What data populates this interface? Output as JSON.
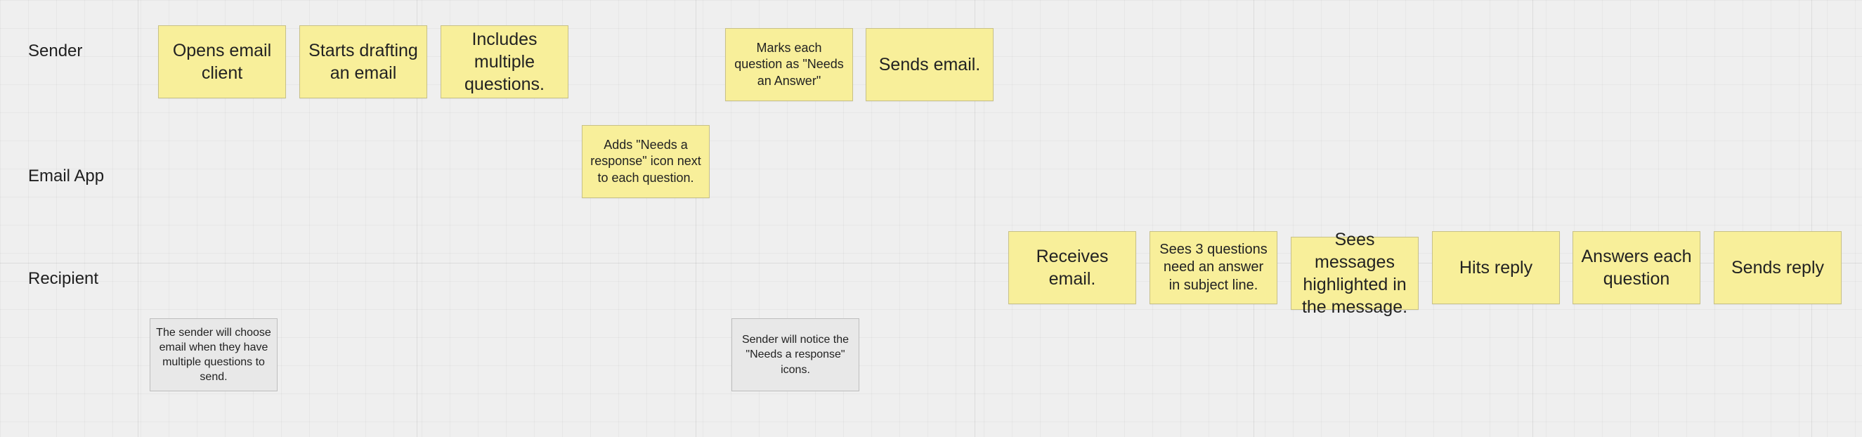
{
  "lanes": {
    "sender": "Sender",
    "email_app": "Email App",
    "recipient": "Recipient"
  },
  "stickies": {
    "opens_email_client": "Opens email client",
    "starts_drafting": "Starts drafting an email",
    "includes_questions": "Includes multiple questions.",
    "adds_needs_response": "Adds \"Needs a response\" icon next to each question.",
    "marks_each_question": "Marks each question as \"Needs an Answer\"",
    "sends_email": "Sends email.",
    "receives_email": "Receives email.",
    "sees_3_questions": "Sees 3 questions need an answer in subject line.",
    "sees_messages_highlighted": "Sees messages highlighted in the message.",
    "hits_reply": "Hits reply",
    "answers_each_question": "Answers each question",
    "sends_reply": "Sends reply"
  },
  "notes": {
    "sender_will_choose": "The sender will choose email when they have multiple questions to send.",
    "sender_will_notice": "Sender will notice the \"Needs a response\" icons."
  },
  "colors": {
    "background": "#efefef",
    "sticky_yellow": "#f8ef9a",
    "note_gray": "#e8e8e8"
  }
}
